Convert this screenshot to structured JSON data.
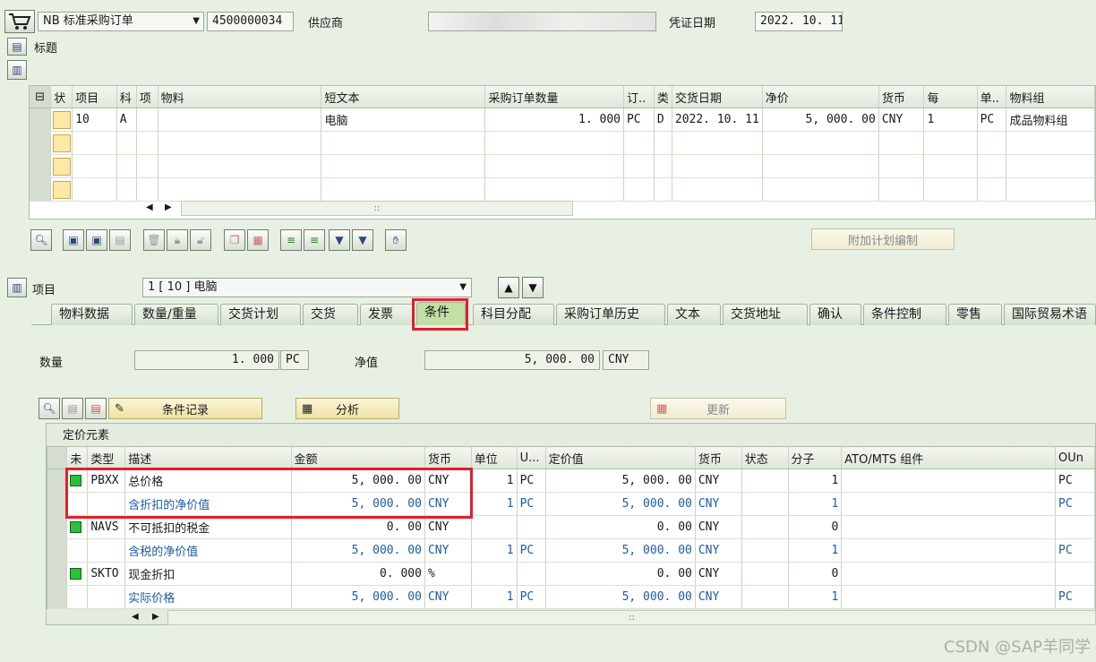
{
  "header": {
    "doc_type": "NB 标准采购订单",
    "po_number": "4500000034",
    "vendor_label": "供应商",
    "vendor_value": "",
    "doc_date_label": "凭证日期",
    "doc_date": "2022. 10. 11",
    "title_label": "标题"
  },
  "items_table": {
    "columns": [
      "状",
      "项目",
      "科",
      "项",
      "物料",
      "短文本",
      "采购订单数量",
      "订..",
      "类",
      "交货日期",
      "净价",
      "货币",
      "每",
      "单..",
      "物料组"
    ],
    "rows": [
      {
        "item": "10",
        "acct": "A",
        "cat": "",
        "material": "",
        "short_text": "电脑",
        "qty": "1. 000",
        "uom": "PC",
        "dtype": "D",
        "delivery": "2022. 10. 11",
        "price": "5, 000. 00",
        "currency": "CNY",
        "per": "1",
        "unit": "PC",
        "mat_group": "成品物料组"
      }
    ]
  },
  "toolbar": {
    "additional_planning": "附加计划编制"
  },
  "item_detail": {
    "label": "项目",
    "selected": "1 [ 10 ] 电脑"
  },
  "tabs": [
    "物料数据",
    "数量/重量",
    "交货计划",
    "交货",
    "发票",
    "条件",
    "科目分配",
    "采购订单历史",
    "文本",
    "交货地址",
    "确认",
    "条件控制",
    "零售",
    "国际贸易术语"
  ],
  "conditions": {
    "qty_label": "数量",
    "qty_value": "1. 000",
    "qty_unit": "PC",
    "net_label": "净值",
    "net_value": "5, 000. 00",
    "net_currency": "CNY",
    "cond_record_btn": "条件记录",
    "analysis_btn": "分析",
    "update_btn": "更新",
    "pricing_title": "定价元素",
    "columns": [
      "未",
      "类型",
      "描述",
      "金额",
      "货币",
      "单位",
      "U...",
      "定价值",
      "货币",
      "状态",
      "分子",
      "ATO/MTS 组件",
      "OUn"
    ],
    "rows": [
      {
        "led": true,
        "type": "PBXX",
        "desc": "总价格",
        "amount": "5, 000. 00",
        "curr": "CNY",
        "per": "1",
        "uom": "PC",
        "value": "5, 000. 00",
        "vcurr": "CNY",
        "numer": "1",
        "oun": "PC",
        "subtotal": false
      },
      {
        "led": false,
        "type": "",
        "desc": "含折扣的净价值",
        "amount": "5, 000. 00",
        "curr": "CNY",
        "per": "1",
        "uom": "PC",
        "value": "5, 000. 00",
        "vcurr": "CNY",
        "numer": "1",
        "oun": "PC",
        "subtotal": true
      },
      {
        "led": true,
        "type": "NAVS",
        "desc": "不可抵扣的税金",
        "amount": "0. 00",
        "curr": "CNY",
        "per": "",
        "uom": "",
        "value": "0. 00",
        "vcurr": "CNY",
        "numer": "0",
        "oun": "",
        "subtotal": false
      },
      {
        "led": false,
        "type": "",
        "desc": "含税的净价值",
        "amount": "5, 000. 00",
        "curr": "CNY",
        "per": "1",
        "uom": "PC",
        "value": "5, 000. 00",
        "vcurr": "CNY",
        "numer": "1",
        "oun": "PC",
        "subtotal": true
      },
      {
        "led": true,
        "type": "SKTO",
        "desc": "现金折扣",
        "amount": "0. 000",
        "curr": "%",
        "per": "",
        "uom": "",
        "value": "0. 00",
        "vcurr": "CNY",
        "numer": "0",
        "oun": "",
        "subtotal": false
      },
      {
        "led": false,
        "type": "",
        "desc": "实际价格",
        "amount": "5, 000. 00",
        "curr": "CNY",
        "per": "1",
        "uom": "PC",
        "value": "5, 000. 00",
        "vcurr": "CNY",
        "numer": "1",
        "oun": "PC",
        "subtotal": true
      }
    ]
  },
  "watermark": "CSDN @SAP羊同学",
  "colors": {
    "highlight": "#e0202a",
    "subtotal_text": "#1f5aa6",
    "active_tab": "#c3dfa5"
  }
}
